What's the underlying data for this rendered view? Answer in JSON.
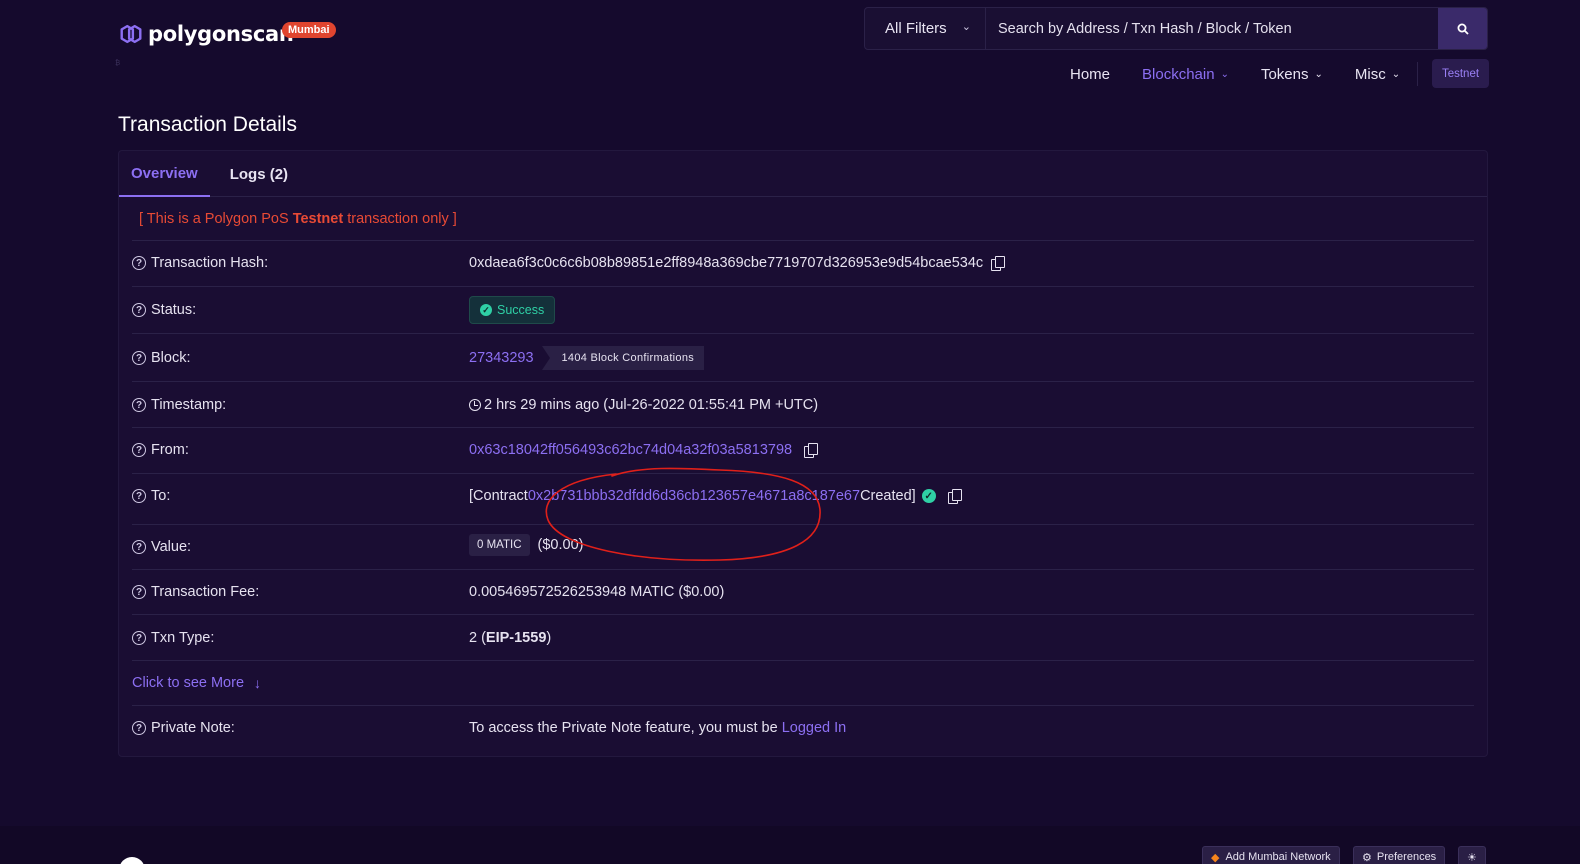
{
  "brand": {
    "name": "polygonscan",
    "network_badge": "Mumbai",
    "sub": "₿"
  },
  "search": {
    "filter_label": "All Filters",
    "placeholder": "Search by Address / Txn Hash / Block / Token"
  },
  "nav": {
    "items": [
      {
        "label": "Home"
      },
      {
        "label": "Blockchain"
      },
      {
        "label": "Tokens"
      },
      {
        "label": "Misc"
      }
    ],
    "testnet_label": "Testnet"
  },
  "page_title": "Transaction Details",
  "tabs": [
    {
      "label": "Overview"
    },
    {
      "label": "Logs (2)"
    }
  ],
  "notice": {
    "prefix": "[ This is a Polygon PoS ",
    "bold": "Testnet",
    "suffix": " transaction only ]"
  },
  "details": {
    "tx_hash": {
      "label": "Transaction Hash:",
      "value": "0xdaea6f3c0c6c6b08b89851e2ff8948a369cbe7719707d326953e9d54bcae534c"
    },
    "status": {
      "label": "Status:",
      "value": "Success"
    },
    "block": {
      "label": "Block:",
      "value": "27343293",
      "confirmations": "1404 Block Confirmations"
    },
    "timestamp": {
      "label": "Timestamp:",
      "value": "2 hrs 29 mins ago (Jul-26-2022 01:55:41 PM +UTC)"
    },
    "from": {
      "label": "From:",
      "value": "0x63c18042ff056493c62bc74d04a32f03a5813798"
    },
    "to": {
      "label": "To:",
      "prefix": "[Contract ",
      "value": "0x2b731bbb32dfdd6d36cb123657e4671a8c187e67",
      "suffix": " Created]"
    },
    "value": {
      "label": "Value:",
      "amount": "0 MATIC",
      "usd": "($0.00)"
    },
    "fee": {
      "label": "Transaction Fee:",
      "value": "0.005469572526253948 MATIC ($0.00)"
    },
    "txn_type": {
      "label": "Txn Type:",
      "prefix": "2 (",
      "bold": "EIP-1559",
      "suffix": ")"
    },
    "see_more": "Click to see More",
    "private_note": {
      "label": "Private Note:",
      "text": "To access the Private Note feature, you must be ",
      "link": "Logged In"
    }
  },
  "footer": {
    "add_network": "Add Mumbai Network",
    "preferences": "Preferences"
  },
  "colors": {
    "accent": "#8c6ff2",
    "success": "#2fd0a5",
    "notice": "#e84a35",
    "annotation": "#e0201a",
    "bg": "#150a2d"
  }
}
